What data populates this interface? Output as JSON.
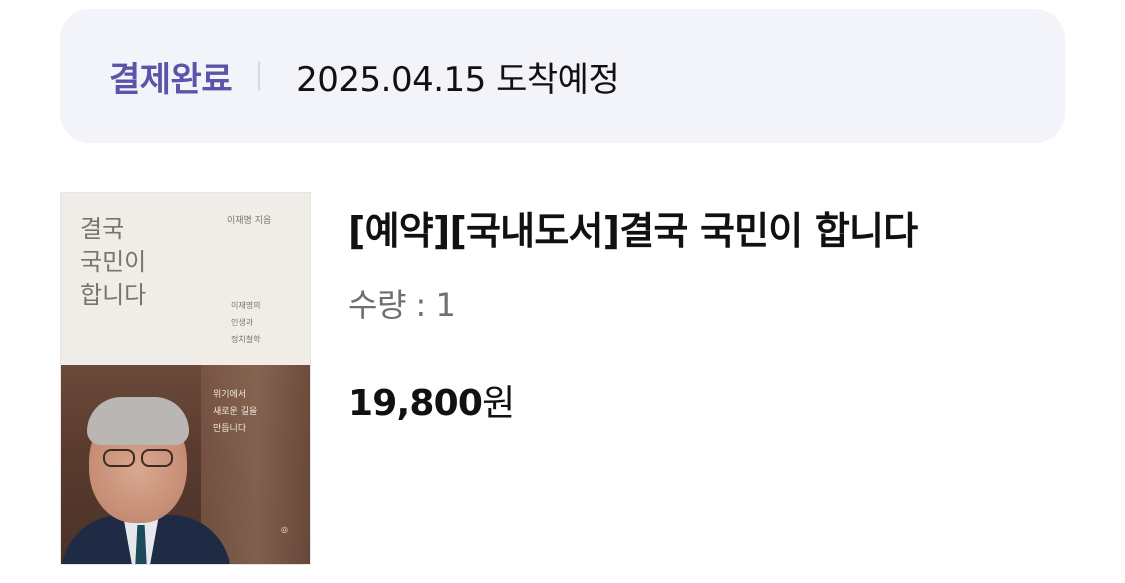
{
  "order_status": {
    "status_label": "결제완료",
    "arrival_text": "2025.04.15 도착예정"
  },
  "product": {
    "title": "[예약][국내도서]결국 국민이 합니다",
    "quantity_text": "수량 : 1",
    "price_value": "19,800",
    "price_unit": "원",
    "cover": {
      "title_text": "결국\n국민이\n합니다",
      "author_text": "이재명 지음",
      "subtitle_text": "이재명의\n인생과\n정치철학",
      "tagline_text": "위기에서\n새로운 길을\n만듭니다"
    }
  },
  "colors": {
    "status_accent": "#5a55a8",
    "status_bg": "#f3f3fa"
  }
}
